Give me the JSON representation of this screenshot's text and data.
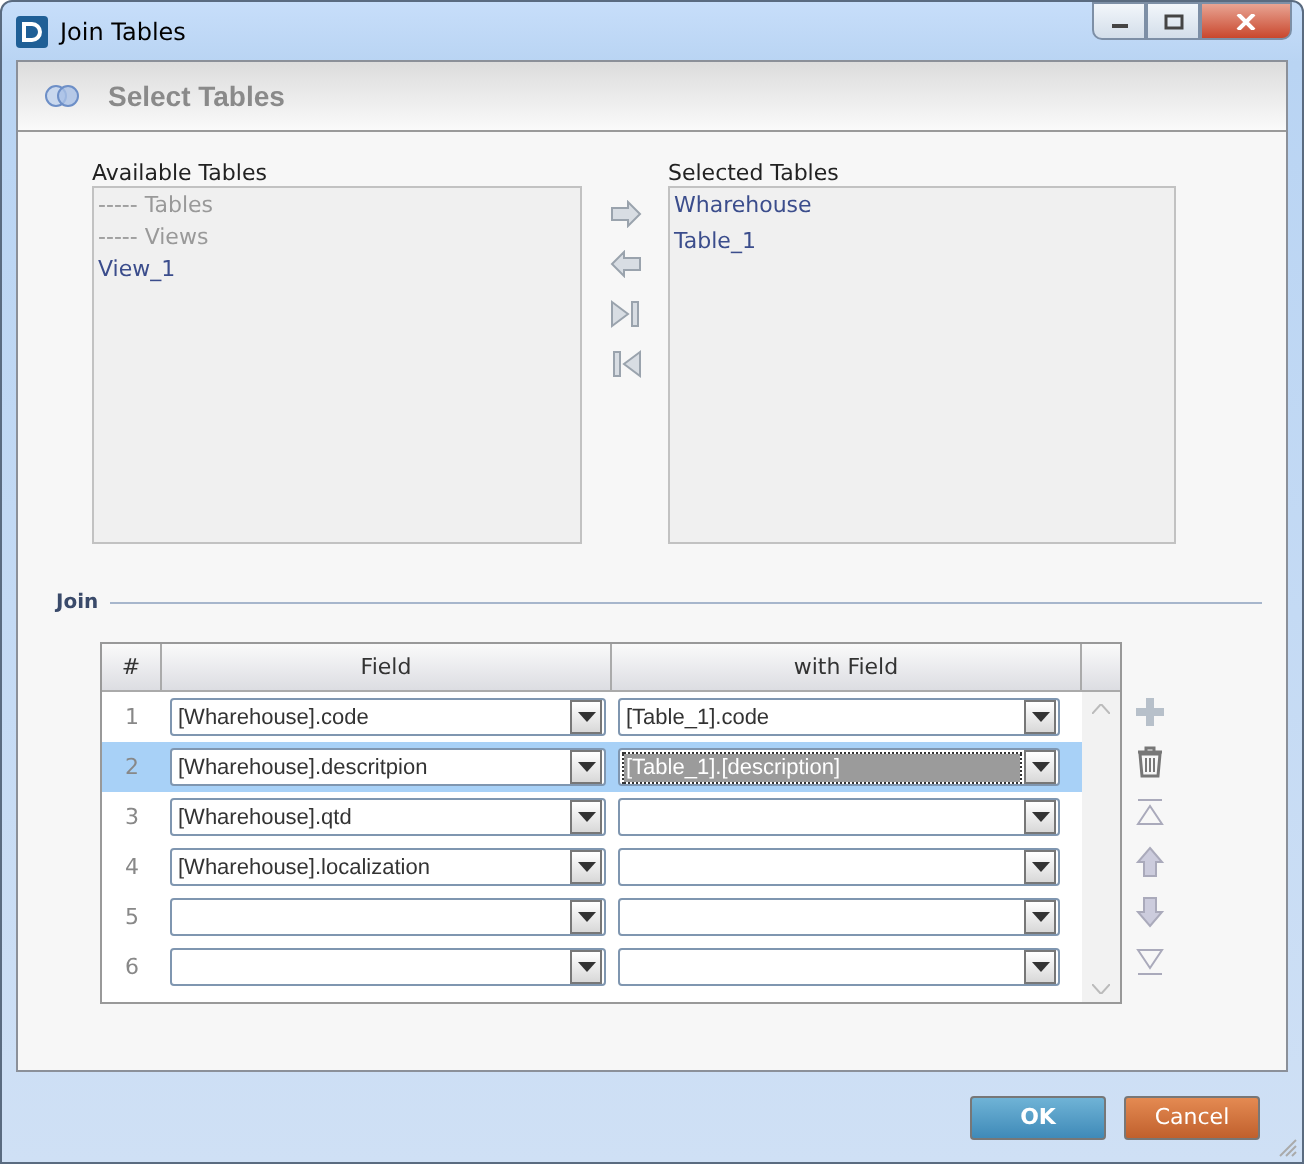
{
  "window": {
    "title": "Join Tables"
  },
  "header": {
    "title": "Select Tables"
  },
  "available_tables": {
    "label": "Available Tables",
    "items": [
      {
        "text": "----- Tables",
        "kind": "group"
      },
      {
        "text": "----- Views",
        "kind": "group"
      },
      {
        "text": "View_1",
        "kind": "item"
      }
    ]
  },
  "selected_tables": {
    "label": "Selected Tables",
    "items": [
      {
        "text": "Wharehouse",
        "kind": "item"
      },
      {
        "text": "Table_1",
        "kind": "item"
      }
    ]
  },
  "join": {
    "label": "Join",
    "columns": [
      "#",
      "Field",
      "with Field"
    ],
    "rows": [
      {
        "number": "1",
        "field": "[Wharehouse].code",
        "with_field": "[Table_1].code",
        "selected": false,
        "editing": false
      },
      {
        "number": "2",
        "field": "[Wharehouse].descritpion",
        "with_field": "[Table_1].[description]",
        "selected": true,
        "editing": true
      },
      {
        "number": "3",
        "field": "[Wharehouse].qtd",
        "selected": false,
        "editing": false
      },
      {
        "number": "4",
        "field": "[Wharehouse].localization",
        "selected": false,
        "editing": false
      },
      {
        "number": "5",
        "selected": false,
        "editing": false
      },
      {
        "number": "6",
        "selected": false,
        "editing": false
      }
    ]
  },
  "buttons": [
    {
      "label": "OK",
      "kind": "primary"
    },
    {
      "label": "Cancel",
      "kind": "cancel"
    }
  ]
}
